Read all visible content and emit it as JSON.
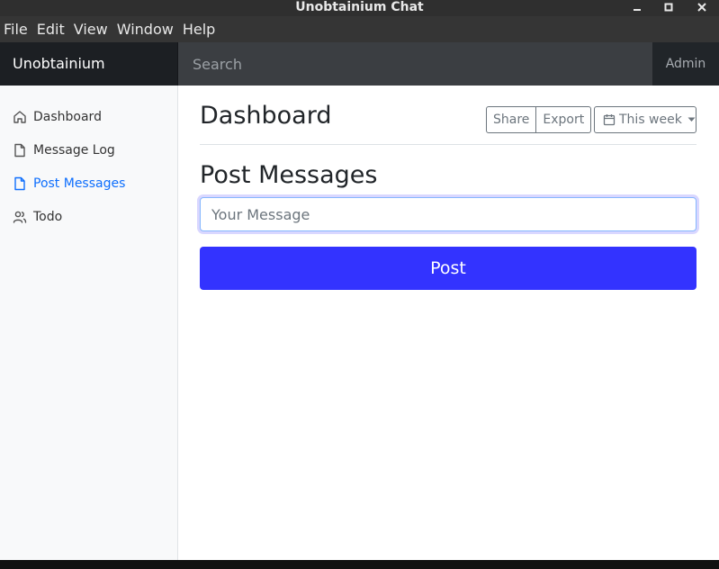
{
  "window": {
    "title": "Unobtainium Chat",
    "controls": [
      "minimize-icon",
      "maximize-icon",
      "close-icon"
    ]
  },
  "menubar": {
    "items": [
      "File",
      "Edit",
      "View",
      "Window",
      "Help"
    ]
  },
  "navbar": {
    "brand": "Unobtainium",
    "search_placeholder": "Search",
    "user": "Admin"
  },
  "sidebar": {
    "items": [
      {
        "label": "Dashboard",
        "icon": "home-icon",
        "active": false
      },
      {
        "label": "Message Log",
        "icon": "file-icon",
        "active": false
      },
      {
        "label": "Post Messages",
        "icon": "file-icon",
        "active": true
      },
      {
        "label": "Todo",
        "icon": "users-icon",
        "active": false
      }
    ]
  },
  "main": {
    "title": "Dashboard",
    "share_label": "Share",
    "export_label": "Export",
    "period_label": "This week",
    "section_title": "Post Messages",
    "message_placeholder": "Your Message",
    "post_label": "Post"
  },
  "colors": {
    "accent": "#0d6efd",
    "post_button": "#3333ff",
    "navbar": "#212529"
  }
}
